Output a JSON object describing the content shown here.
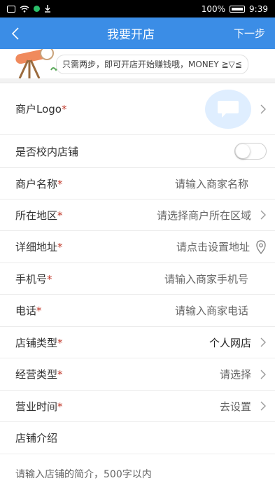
{
  "status_bar": {
    "battery": "100%",
    "time": "9:39",
    "icons": [
      "sim-icon",
      "wifi-icon",
      "app-dot-icon",
      "download-icon"
    ]
  },
  "header": {
    "title": "我要开店",
    "next_label": "下一步"
  },
  "banner": {
    "text": "只需两步，即可开店开始赚钱哦，MONEY ≧▽≦"
  },
  "form": {
    "logo_label": "商户Logo",
    "campus_label": "是否校内店铺",
    "campus_on": false,
    "name_label": "商户名称",
    "name_placeholder": "请输入商家名称",
    "region_label": "所在地区",
    "region_placeholder": "请选择商户所在区域",
    "address_label": "详细地址",
    "address_placeholder": "请点击设置地址",
    "mobile_label": "手机号",
    "mobile_placeholder": "请输入商家手机号",
    "phone_label": "电话",
    "phone_placeholder": "请输入商家电话",
    "store_type_label": "店铺类型",
    "store_type_value": "个人网店",
    "business_type_label": "经营类型",
    "business_type_value": "请选择",
    "hours_label": "营业时间",
    "hours_value": "去设置",
    "intro_label": "店铺介绍",
    "intro_placeholder": "请输入店铺的简介，500字以内"
  },
  "required_mark": "*"
}
